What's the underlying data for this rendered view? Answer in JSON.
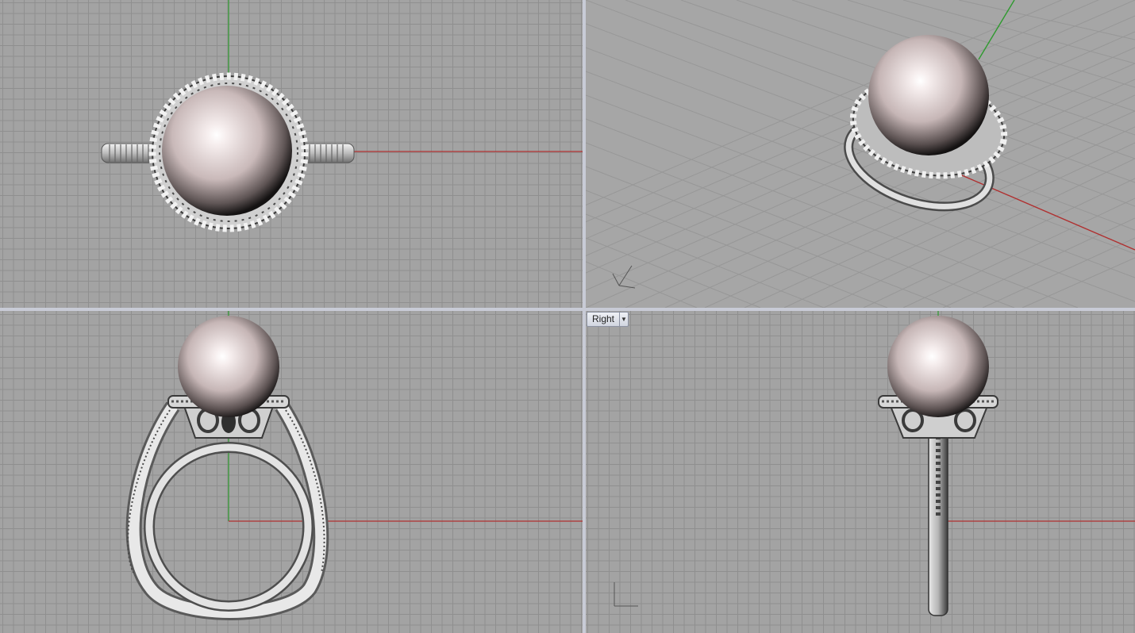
{
  "viewports": {
    "top": {
      "name": ""
    },
    "perspective": {
      "name": ""
    },
    "front": {
      "name": ""
    },
    "right": {
      "name": "Right",
      "menu_icon": "dropdown-arrow-icon"
    }
  },
  "colors": {
    "grid_background": "#a3a3a3",
    "grid_line": "#8f8f8f",
    "x_axis": "#b03030",
    "y_axis": "#2f9a2f",
    "pearl": "#e9dcdc",
    "metal": "#e6e6e6",
    "divider": "#c8cbd6"
  }
}
